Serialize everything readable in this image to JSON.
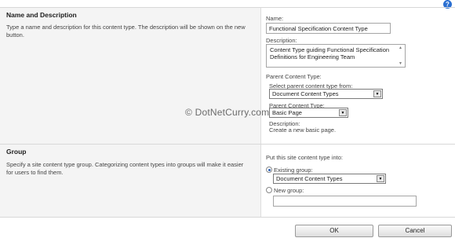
{
  "name_section": {
    "title": "Name and Description",
    "description": "Type a name and description for this content type. The description will be shown on the new button.",
    "name_label": "Name:",
    "name_value": "Functional Specification Content Type",
    "description_label": "Description:",
    "description_value": "Content Type guiding Functional Specification Definitions for Engineering Team",
    "parent_label": "Parent Content Type:",
    "select_from_label": "Select parent content type from:",
    "select_from_value": "Document Content Types",
    "parent_ct_label": "Parent Content Type:",
    "parent_ct_value": "Basic Page",
    "desc2_label": "Description:",
    "desc2_value": "Create a new basic page."
  },
  "group_section": {
    "title": "Group",
    "description": "Specify a site content type group. Categorizing content types into groups will make it easier for users to find them.",
    "put_into_label": "Put this site content type into:",
    "existing_label": "Existing group:",
    "existing_value": "Document Content Types",
    "existing_selected": true,
    "new_label": "New group:",
    "new_value": ""
  },
  "watermark": "© DotNetCurry.com",
  "buttons": {
    "ok": "OK",
    "cancel": "Cancel"
  },
  "icons": {
    "help": "help-icon"
  }
}
